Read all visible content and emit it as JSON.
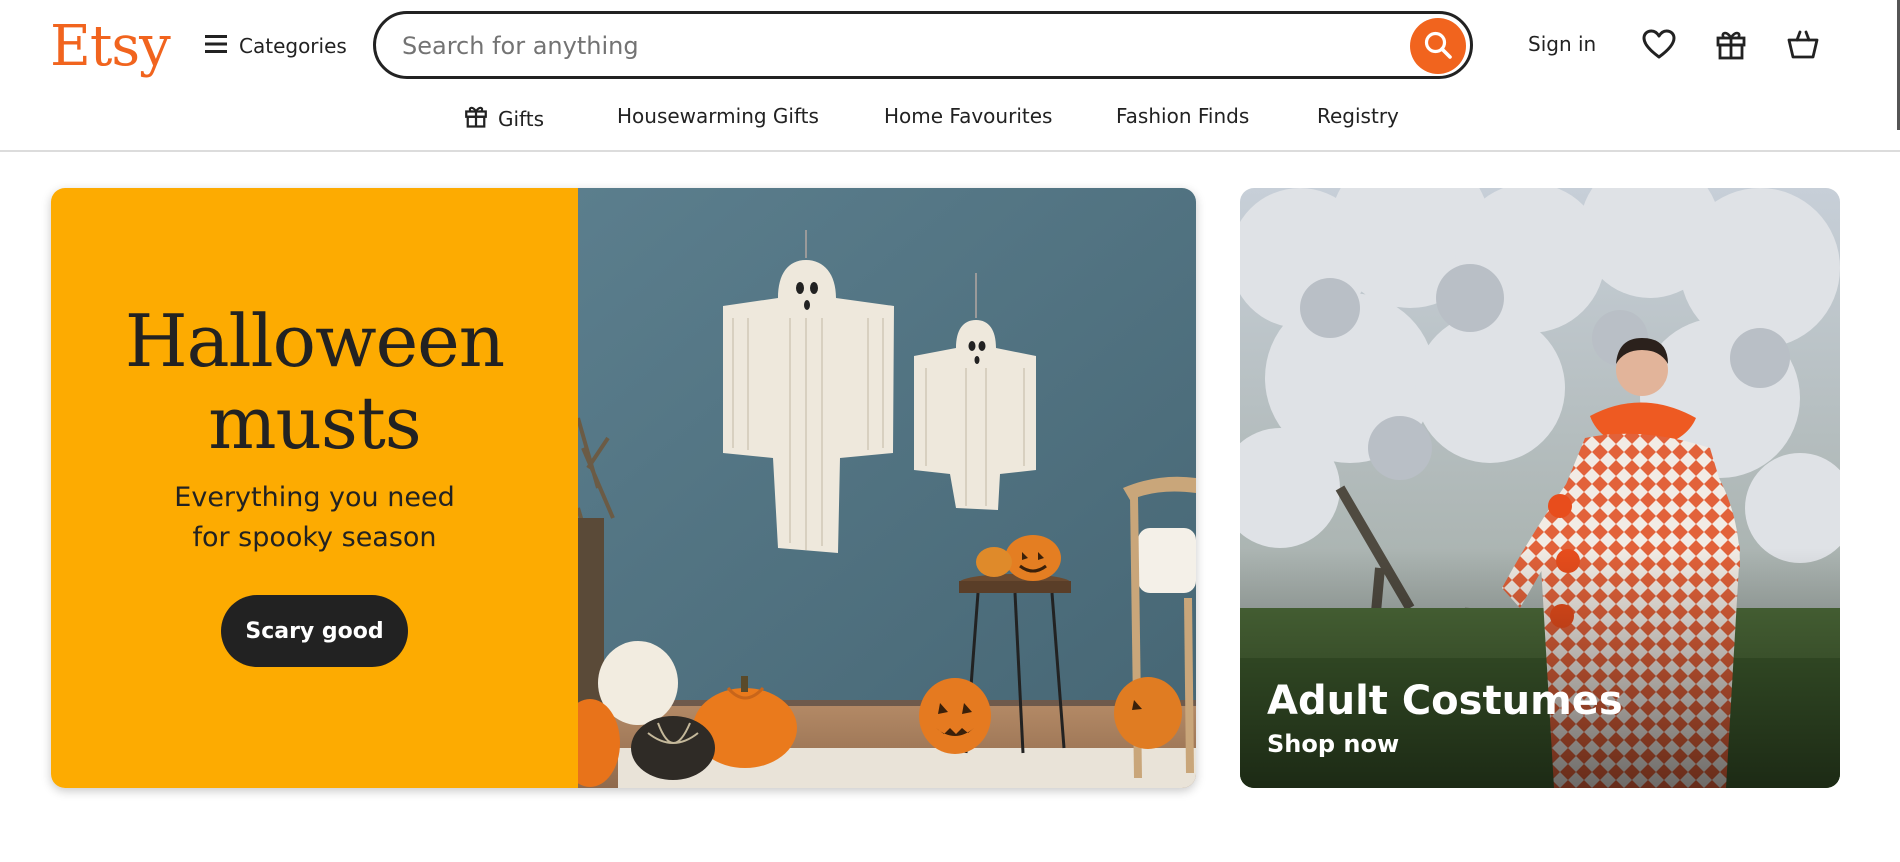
{
  "header": {
    "logo": "Etsy",
    "categories_label": "Categories",
    "search": {
      "placeholder": "Search for anything",
      "value": ""
    },
    "sign_in_label": "Sign in",
    "icons": [
      "menu-icon",
      "search-icon",
      "heart-icon",
      "gift-icon",
      "basket-icon"
    ]
  },
  "nav": {
    "items": [
      {
        "label": "Gifts",
        "icon": "gift-icon"
      },
      {
        "label": "Housewarming Gifts"
      },
      {
        "label": "Home Favourites"
      },
      {
        "label": "Fashion Finds"
      },
      {
        "label": "Registry"
      }
    ]
  },
  "hero": {
    "title_line1": "Halloween",
    "title_line2": "musts",
    "subtitle_line1": "Everything you need",
    "subtitle_line2": "for spooky season",
    "button_label": "Scary good",
    "panel_color": "#fdab01"
  },
  "side_card": {
    "title": "Adult Costumes",
    "link": "Shop now"
  },
  "colors": {
    "brand": "#f1641e",
    "text": "#222222",
    "hero_panel": "#fdab01"
  }
}
